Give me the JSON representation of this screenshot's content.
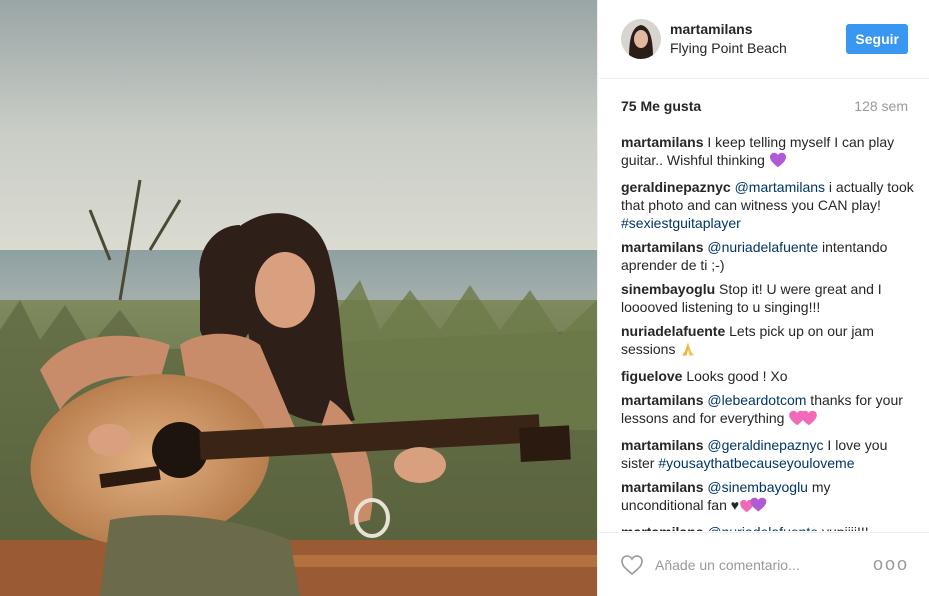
{
  "header": {
    "username": "martamilans",
    "location": "Flying Point Beach",
    "follow_label": "Seguir"
  },
  "stats": {
    "likes": "75 Me gusta",
    "age": "128 sem"
  },
  "comments": [
    {
      "author": "martamilans",
      "parts": [
        {
          "t": "I keep telling myself I can play guitar.. Wishful thinking "
        }
      ],
      "emoji": "purple-heart"
    },
    {
      "author": "geraldinepaznyc",
      "parts": [
        {
          "t": "@martamilans",
          "m": true
        },
        {
          "t": " i actually took that photo and can witness you CAN play! "
        },
        {
          "t": "#sexiestguitaplayer",
          "m": true
        }
      ]
    },
    {
      "author": "martamilans",
      "parts": [
        {
          "t": "@nuriadelafuente",
          "m": true
        },
        {
          "t": " intentando aprender de ti ;-)"
        }
      ]
    },
    {
      "author": "sinembayoglu",
      "parts": [
        {
          "t": "Stop it! U were great and I looooved listening to u singing!!!"
        }
      ]
    },
    {
      "author": "nuriadelafuente",
      "parts": [
        {
          "t": "Lets pick up on our jam sessions "
        }
      ],
      "emoji": "praying-hands"
    },
    {
      "author": "figuelove",
      "parts": [
        {
          "t": "Looks good ! Xo"
        }
      ]
    },
    {
      "author": "martamilans",
      "parts": [
        {
          "t": "@lebeardotcom",
          "m": true
        },
        {
          "t": " thanks for your lessons and for everything "
        }
      ],
      "emoji": "two-pink-hearts"
    },
    {
      "author": "martamilans",
      "parts": [
        {
          "t": "@geraldinepaznyc",
          "m": true
        },
        {
          "t": " I love you sister "
        },
        {
          "t": "#yousaythatbecauseyouloveme",
          "m": true
        }
      ]
    },
    {
      "author": "martamilans",
      "parts": [
        {
          "t": "@sinembayoglu",
          "m": true
        },
        {
          "t": " my unconditional fan ♥"
        }
      ],
      "emoji": "heart-cluster"
    },
    {
      "author": "martamilans",
      "parts": [
        {
          "t": "@nuriadelafuente",
          "m": true
        },
        {
          "t": " yupiiii!!!"
        }
      ]
    }
  ],
  "footer": {
    "add_comment_placeholder": "Añade un comentario...",
    "more_label": "ooo"
  },
  "colors": {
    "accent": "#3897f0",
    "mention": "#003569",
    "muted": "#999999"
  },
  "icons": [
    "heart-icon",
    "more-options-icon",
    "avatar"
  ]
}
